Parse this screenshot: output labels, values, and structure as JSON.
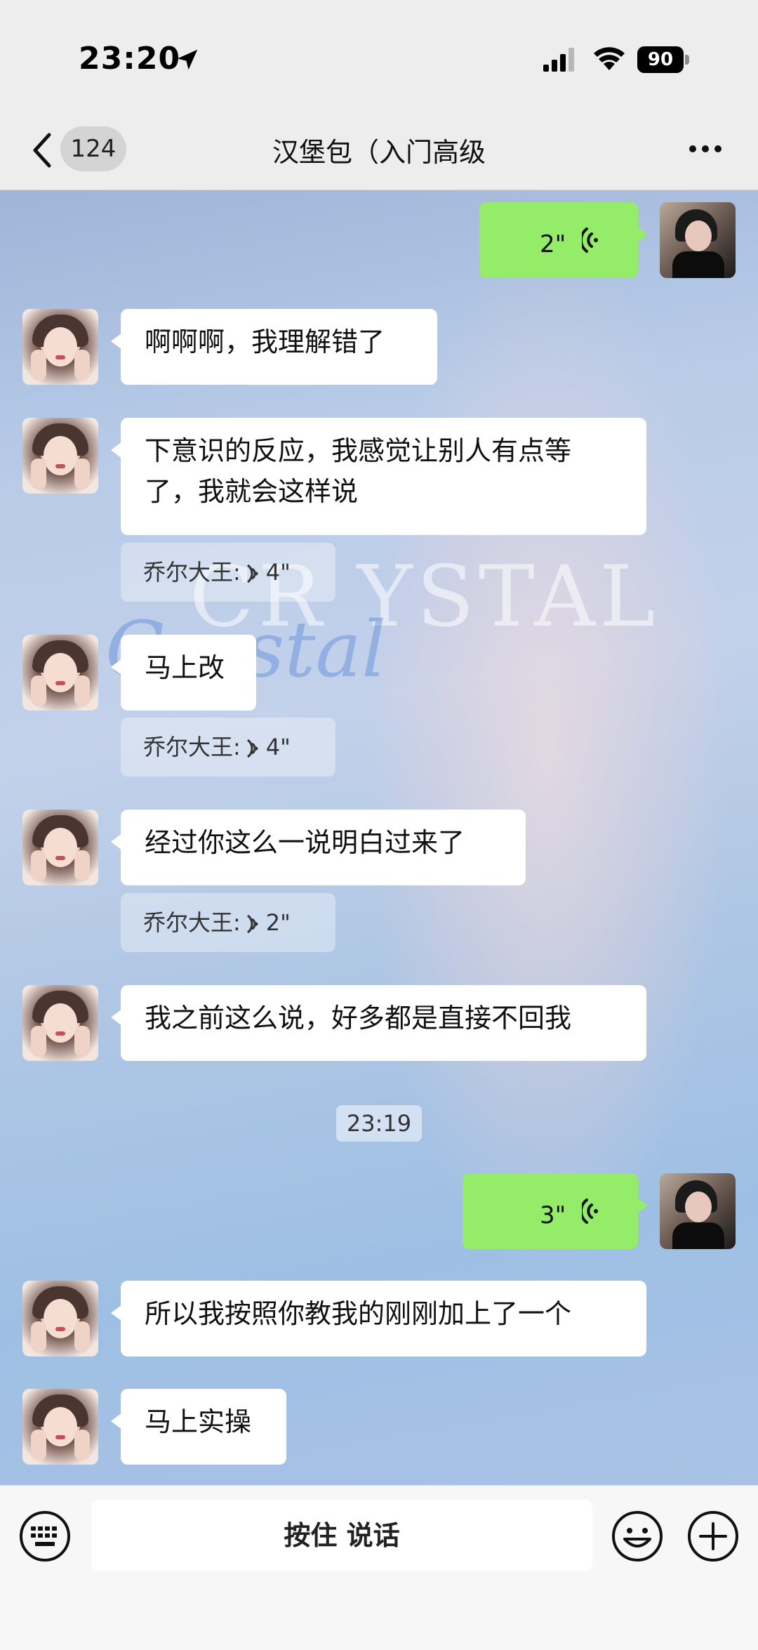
{
  "status": {
    "time": "23:20",
    "battery": "90"
  },
  "nav": {
    "badge": "124",
    "title": "汉堡包（入门高级"
  },
  "watermark": {
    "line1": "CRYSTAL",
    "line2": "Crystal",
    "line3": "CR YSTAL"
  },
  "messages": [
    {
      "side": "right",
      "type": "voice",
      "duration": "2\""
    },
    {
      "side": "left",
      "type": "text",
      "lines": [
        "啊啊啊，我理解错了"
      ]
    },
    {
      "side": "left",
      "type": "text",
      "lines": [
        "下意识的反应，我感觉让别人有点等",
        "了，我就会这样说"
      ]
    },
    {
      "type": "quote",
      "sender": "乔尔大王:",
      "duration": "4\""
    },
    {
      "side": "left",
      "type": "text",
      "lines": [
        "马上改"
      ]
    },
    {
      "type": "quote",
      "sender": "乔尔大王:",
      "duration": "4\""
    },
    {
      "side": "left",
      "type": "text",
      "lines": [
        "经过你这么一说明白过来了"
      ]
    },
    {
      "type": "quote",
      "sender": "乔尔大王:",
      "duration": "2\""
    },
    {
      "side": "left",
      "type": "text",
      "lines": [
        "我之前这么说，好多都是直接不回我"
      ]
    },
    {
      "type": "timestamp",
      "text": "23:19"
    },
    {
      "side": "right",
      "type": "voice",
      "duration": "3\""
    },
    {
      "side": "left",
      "type": "text",
      "lines": [
        "所以我按照你教我的刚刚加上了一个"
      ]
    },
    {
      "side": "left",
      "type": "text",
      "lines": [
        "马上实操"
      ]
    }
  ],
  "input": {
    "hold_label": "按住 说话"
  },
  "icons": {
    "back": "chevron-left-icon",
    "more": "more-icon",
    "keyboard": "keyboard-icon",
    "emoji": "emoji-icon",
    "plus": "plus-icon",
    "voice": "voice-wave-icon"
  },
  "colors": {
    "sent_bubble": "#95ec69",
    "received_bubble": "#ffffff",
    "background": "#ededed"
  }
}
